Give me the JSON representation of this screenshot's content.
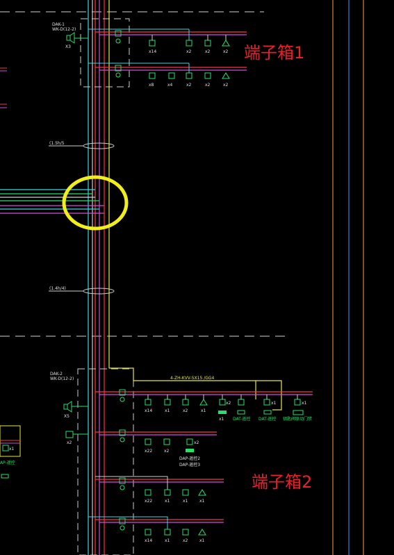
{
  "labels": {
    "box1": "端子箱1",
    "box2": "端子箱2",
    "cable_top": "(1.5h/5",
    "cable_mid": "(1.4h/4)",
    "yellow_line": "4-ZH-KVV-5X15 /GG4",
    "block_top": "DAK-1\nWK-D(12-2)",
    "block_bottom": "端子箱2"
  },
  "box1_row1": [
    "x14",
    "x2",
    "x2",
    "x2"
  ],
  "box1_row2": [
    "x8",
    "x4",
    "x2",
    "x2",
    "x2"
  ],
  "box2_row1": [
    "x14",
    "x1",
    "x2",
    "x1",
    "x2",
    "x1",
    "x1"
  ],
  "box2_row1_sub": [
    "x1",
    "DAT-遥控",
    "DAT-遥控",
    "钥匙阀联动门禁"
  ],
  "box2_row2": [
    "x22",
    "x2",
    "x2"
  ],
  "box2_row2_sub": [
    "DAP-遥控2",
    "DAP-遥控3"
  ],
  "box2_row3": [
    "x22",
    "x1",
    "x1",
    "x1"
  ],
  "box2_row4": [
    "x14",
    "x1",
    "x2",
    "x1"
  ],
  "speaker_labels": [
    "X3",
    "X5",
    "x2"
  ],
  "left_labels": [
    "x1",
    "AP-遥控"
  ],
  "colors": {
    "red_text": "#e8202a",
    "yellow_circle": "#f1ee1c",
    "cyan": "#3fd6e6",
    "magenta": "#d24cd8",
    "red_bus": "#ff3344",
    "green": "#27e06a",
    "orange_border": "#d98a2a",
    "blue_border": "#3a7fe0"
  }
}
